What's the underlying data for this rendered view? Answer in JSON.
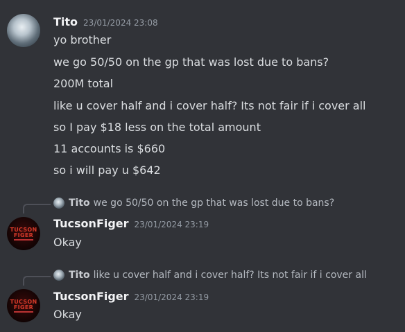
{
  "messages": [
    {
      "username": "Tito",
      "timestamp": "23/01/2024 23:08",
      "avatar": "tito-avatar",
      "lines": [
        "yo brother",
        "we go 50/50 on the gp that was lost due to bans?",
        "200M total",
        "like u cover half and i cover half? Its not fair if i cover all",
        "so I pay $18 less on the total amount",
        "11 accounts is $660",
        "so i will pay u $642"
      ]
    },
    {
      "reply_to": {
        "username": "Tito",
        "text": "we go 50/50 on the gp that was lost due to bans?"
      },
      "username": "TucsonFiger",
      "timestamp": "23/01/2024 23:19",
      "avatar": "tucsonfiger-avatar",
      "lines": [
        "Okay"
      ]
    },
    {
      "reply_to": {
        "username": "Tito",
        "text": "like u cover half and i cover half? Its not fair if i cover all"
      },
      "username": "TucsonFiger",
      "timestamp": "23/01/2024 23:19",
      "avatar": "tucsonfiger-avatar",
      "lines": [
        "Okay"
      ]
    }
  ],
  "avatar_logo_text": [
    "TUCSON",
    "FIGER"
  ],
  "colors": {
    "background": "#313338",
    "username": "#f2f3f5",
    "text": "#dbdee1",
    "timestamp": "#949ba4",
    "reply_text": "#b5bac1",
    "logo_red": "#d83a2a"
  }
}
